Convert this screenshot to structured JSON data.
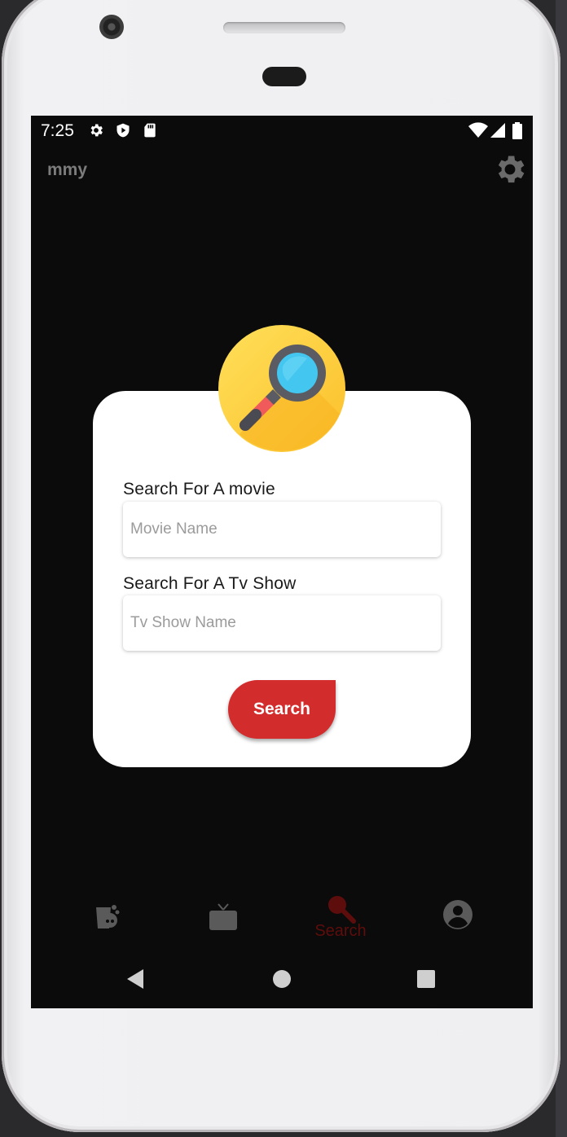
{
  "status_bar": {
    "time": "7:25",
    "icons": [
      "gear-icon",
      "play-protect-icon",
      "sd-card-icon",
      "wifi-icon",
      "signal-icon",
      "battery-icon"
    ]
  },
  "app_bar": {
    "title": "mmy",
    "settings_icon": "gear-icon"
  },
  "search_card": {
    "badge_icon": "magnifier-icon",
    "movie": {
      "label": "Search For A movie",
      "placeholder": "Movie Name",
      "value": ""
    },
    "tv": {
      "label": "Search For A Tv Show",
      "placeholder": "Tv Show Name",
      "value": ""
    },
    "button_label": "Search"
  },
  "bottom_nav": {
    "items": [
      {
        "icon": "popcorn-icon",
        "label": "",
        "active": false
      },
      {
        "icon": "tv-icon",
        "label": "",
        "active": false
      },
      {
        "icon": "search-icon",
        "label": "Search",
        "active": true
      },
      {
        "icon": "account-icon",
        "label": "",
        "active": false
      }
    ]
  },
  "system_nav": [
    "back-icon",
    "home-icon",
    "recents-icon"
  ],
  "colors": {
    "screen_bg": "#0b0b0b",
    "card_bg": "#ffffff",
    "accent_red": "#d22c2c",
    "nav_inactive": "#5a5a5a",
    "nav_active": "#5e0d0d",
    "badge_yellow": "#fcc93b"
  }
}
